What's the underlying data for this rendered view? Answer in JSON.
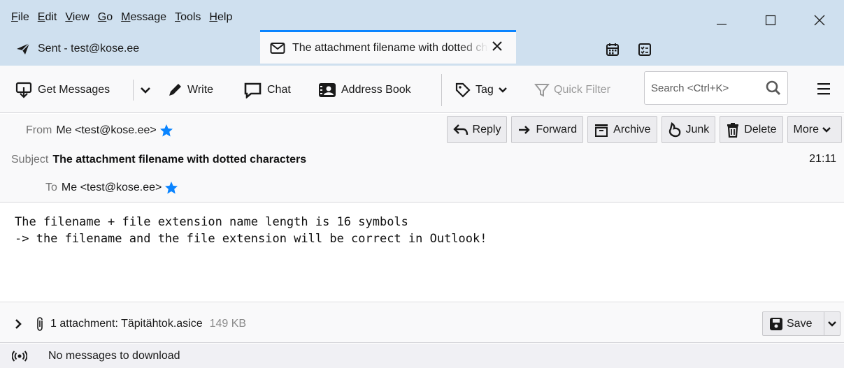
{
  "menu": [
    "File",
    "Edit",
    "View",
    "Go",
    "Message",
    "Tools",
    "Help"
  ],
  "menu_access": [
    "F",
    "E",
    "V",
    "G",
    "M",
    "T",
    "H"
  ],
  "tabs": [
    {
      "label": "Sent - test@kose.ee",
      "icon": "send-icon"
    },
    {
      "label": "The attachment filename with dotted characters",
      "icon": "envelope-icon"
    }
  ],
  "toolbar": {
    "get_messages": "Get Messages",
    "write": "Write",
    "chat": "Chat",
    "address_book": "Address Book",
    "tag": "Tag",
    "quick_filter": "Quick Filter",
    "search_placeholder": "Search <Ctrl+K>"
  },
  "header": {
    "from_label": "From",
    "from_value": "Me <test@kose.ee>",
    "subject_label": "Subject",
    "subject_value": "The attachment filename with dotted characters",
    "to_label": "To",
    "to_value": "Me <test@kose.ee>",
    "time": "21:11",
    "buttons": {
      "reply": "Reply",
      "forward": "Forward",
      "archive": "Archive",
      "junk": "Junk",
      "delete": "Delete",
      "more": "More"
    }
  },
  "body": {
    "line1": "The filename + file extension name length is 16 symbols",
    "line2": "-> the filename and the file extension will be correct in Outlook!"
  },
  "attachment": {
    "summary": "1 attachment: Täpitähtok.asice",
    "size": "149 KB",
    "save": "Save"
  },
  "status": {
    "text": "No messages to download"
  },
  "colors": {
    "accent": "#0a84ff",
    "titlebar": "#cfe0ef",
    "toolbar": "#f9f9fa"
  }
}
